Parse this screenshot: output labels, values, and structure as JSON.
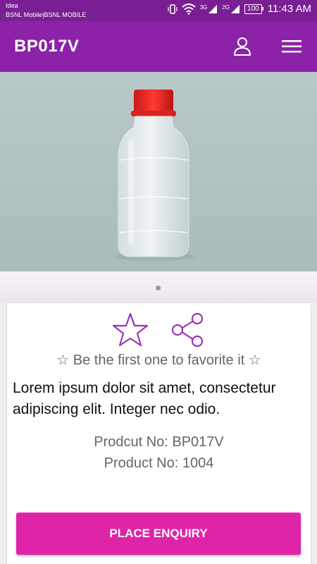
{
  "status_bar": {
    "carrier_1": "Idea",
    "carrier_2": "BSNL Mobile|BSNL MOBILE",
    "network_3g": "3G",
    "network_2g": "2G",
    "battery": "100",
    "time": "11:43 AM"
  },
  "app_bar": {
    "title": "BP017V",
    "icons": [
      "profile-icon",
      "menu-icon"
    ]
  },
  "carousel": {
    "image": "bottle-image",
    "dots": 1,
    "active_index": 0
  },
  "product": {
    "favorite_text": "☆ Be the first one to favorite it ☆",
    "description": "Lorem ipsum dolor sit amet, consectetur adipiscing elit. Integer nec odio.",
    "code_line": "Prodcut No: BP017V",
    "number_line": "Product No: 1004"
  },
  "actions": {
    "enquiry_label": "PLACE ENQUIRY"
  },
  "colors": {
    "status_bar": "#7a1f93",
    "app_bar": "#8b22a8",
    "accent": "#9b34b8",
    "button": "#e024a8"
  }
}
